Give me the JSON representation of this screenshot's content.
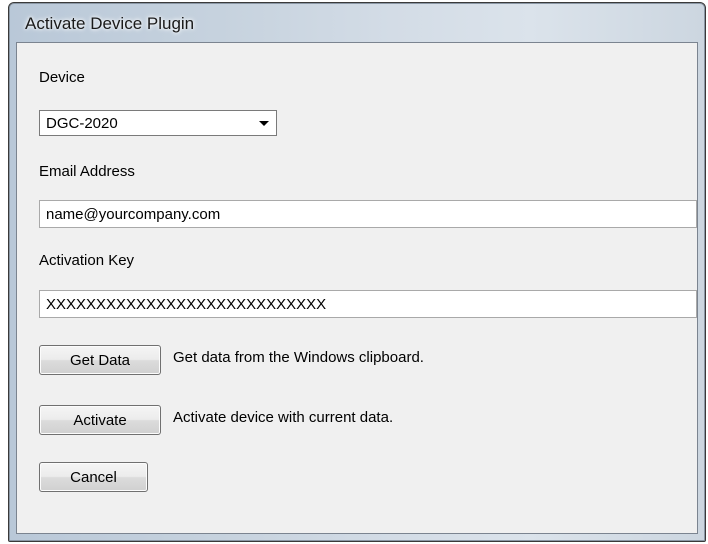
{
  "window": {
    "title": "Activate Device Plugin"
  },
  "device": {
    "label": "Device",
    "selected": "DGC-2020"
  },
  "email": {
    "label": "Email Address",
    "value": "name@yourcompany.com"
  },
  "activation_key": {
    "label": "Activation Key",
    "value": "XXXXXXXXXXXXXXXXXXXXXXXXXXXX"
  },
  "buttons": {
    "get_data": "Get Data",
    "get_data_desc": "Get data from the Windows clipboard.",
    "activate": "Activate",
    "activate_desc": "Activate device with current data.",
    "cancel": "Cancel"
  },
  "icons": {
    "dropdown": "chevron-down-icon"
  }
}
